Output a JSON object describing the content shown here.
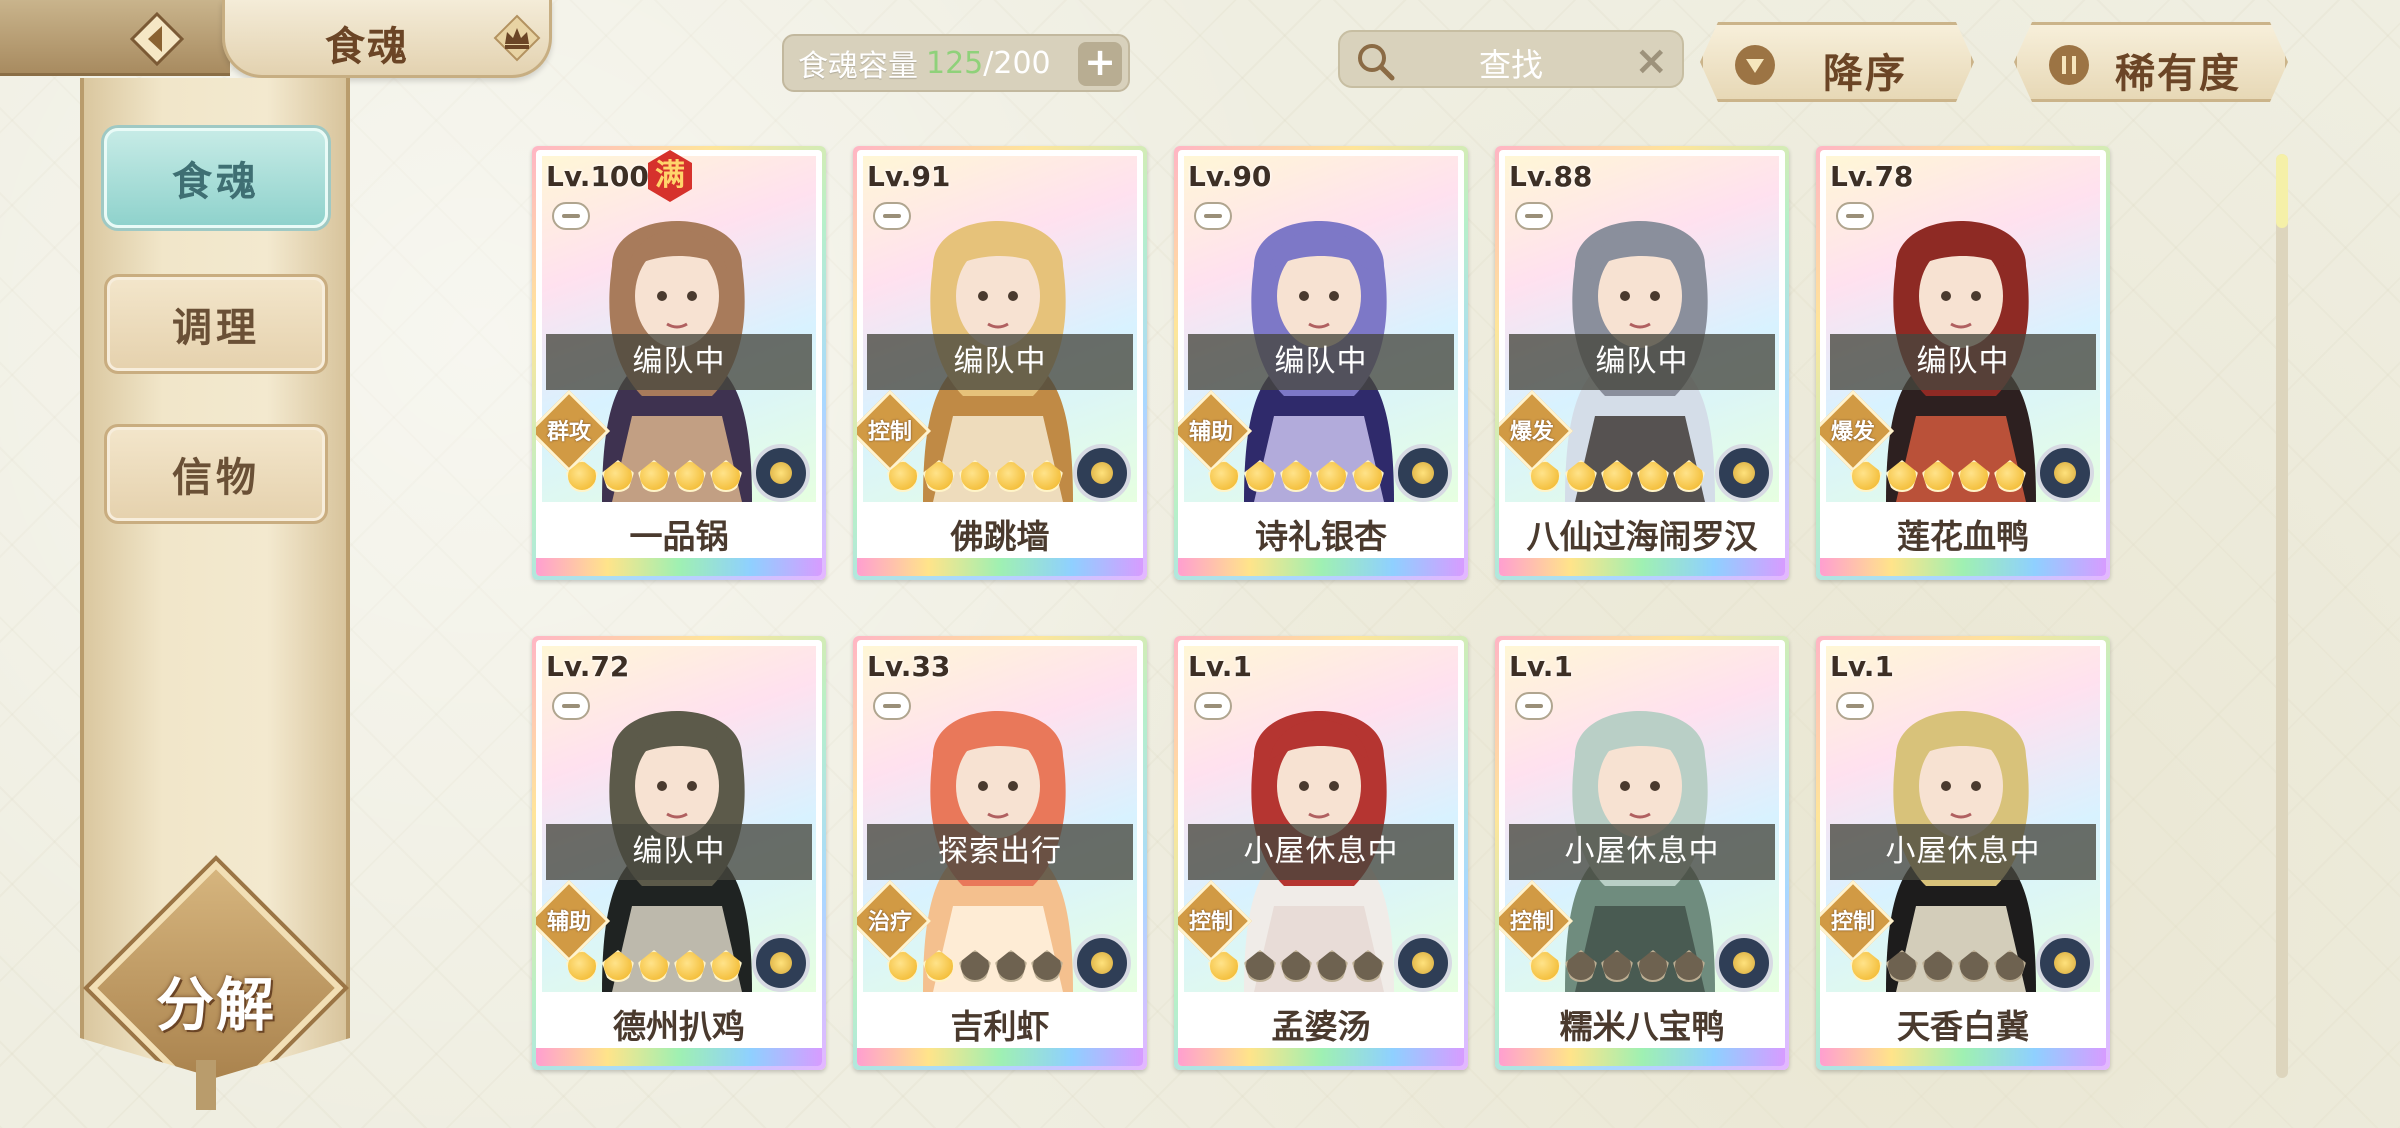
{
  "header": {
    "title": "食魂",
    "capacity_label": "食魂容量",
    "capacity_current": "125",
    "capacity_max": "/200",
    "search_placeholder": "查找",
    "sort_order_label": "降序",
    "sort_key_label": "稀有度"
  },
  "sidebar": {
    "items": [
      {
        "label": "食魂",
        "active": true
      },
      {
        "label": "调理",
        "active": false
      },
      {
        "label": "信物",
        "active": false
      }
    ],
    "decompose_label": "分解"
  },
  "colors": {
    "accent_teal": "#8fd2cc",
    "capacity_green": "#8fd17a",
    "full_badge_red": "#d6322c"
  },
  "cards": [
    {
      "level": "Lv.100",
      "full": "满",
      "status": "编队中",
      "role": "群攻",
      "stars_filled": 5,
      "name": "一品锅",
      "palette": [
        "#3e3250",
        "#a87b5b",
        "#d9b38c"
      ]
    },
    {
      "level": "Lv.91",
      "status": "编队中",
      "role": "控制",
      "stars_filled": 5,
      "name": "佛跳墙",
      "palette": [
        "#c08a45",
        "#e6c27a",
        "#f6ead1"
      ]
    },
    {
      "level": "Lv.90",
      "status": "编队中",
      "role": "辅助",
      "stars_filled": 5,
      "name": "诗礼银杏",
      "palette": [
        "#2f2a6b",
        "#7d78c7",
        "#c9c2ee"
      ]
    },
    {
      "level": "Lv.88",
      "status": "编队中",
      "role": "爆发",
      "stars_filled": 5,
      "name": "八仙过海闹罗汉",
      "palette": [
        "#d4dde8",
        "#8a8f9c",
        "#3f3a36"
      ]
    },
    {
      "level": "Lv.78",
      "status": "编队中",
      "role": "爆发",
      "stars_filled": 5,
      "name": "莲花血鸭",
      "palette": [
        "#2d2020",
        "#8e2a24",
        "#d45a3e"
      ]
    },
    {
      "level": "Lv.72",
      "status": "编队中",
      "role": "辅助",
      "stars_filled": 5,
      "name": "德州扒鸡",
      "palette": [
        "#1f2322",
        "#5c5a4a",
        "#d9d4c4"
      ]
    },
    {
      "level": "Lv.33",
      "status": "探索出行",
      "role": "治疗",
      "stars_filled": 2,
      "name": "吉利虾",
      "palette": [
        "#f4c08e",
        "#e9785a",
        "#fff3e2"
      ]
    },
    {
      "level": "Lv.1",
      "status": "小屋休息中",
      "role": "控制",
      "stars_filled": 1,
      "name": "孟婆汤",
      "palette": [
        "#f0ece8",
        "#b53531",
        "#e6d9d4"
      ]
    },
    {
      "level": "Lv.1",
      "status": "小屋休息中",
      "role": "控制",
      "stars_filled": 1,
      "name": "糯米八宝鸭",
      "palette": [
        "#6f8c7e",
        "#b9cfc6",
        "#43524a"
      ]
    },
    {
      "level": "Lv.1",
      "status": "小屋休息中",
      "role": "控制",
      "stars_filled": 1,
      "name": "天香白冀",
      "palette": [
        "#1d1c1c",
        "#d8c27a",
        "#f3ecd6"
      ]
    }
  ]
}
